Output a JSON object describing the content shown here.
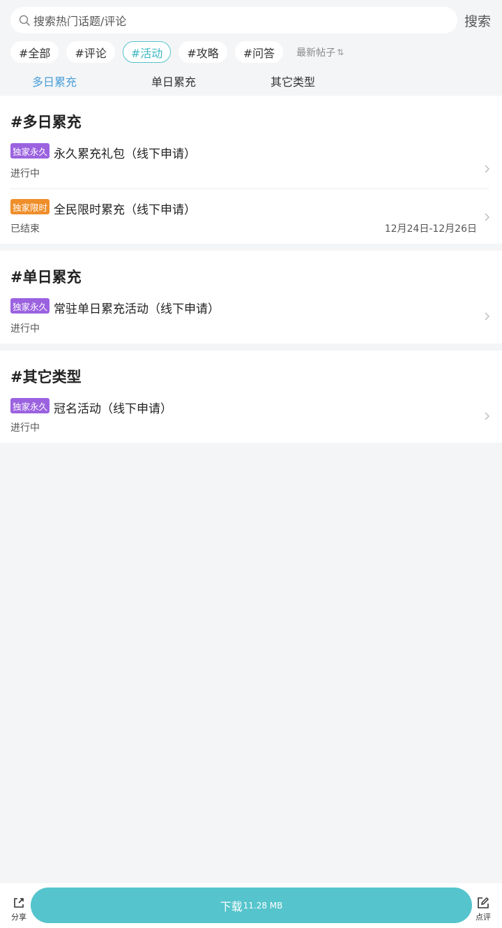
{
  "search": {
    "placeholder": "搜索热门话题/评论",
    "button_label": "搜索"
  },
  "filters": {
    "chips": [
      {
        "label": "#全部",
        "active": false
      },
      {
        "label": "#评论",
        "active": false
      },
      {
        "label": "#活动",
        "active": true
      },
      {
        "label": "#攻略",
        "active": false
      },
      {
        "label": "#问答",
        "active": false
      }
    ],
    "sort_label": "最新帖子",
    "sort_icon": "sort-arrows-icon"
  },
  "tabs": [
    {
      "label": "多日累充",
      "active": true
    },
    {
      "label": "单日累充",
      "active": false
    },
    {
      "label": "其它类型",
      "active": false
    }
  ],
  "sections": [
    {
      "title": "#多日累充",
      "items": [
        {
          "badge": "独家永久",
          "badge_color": "#9b62e0",
          "title": "永久累充礼包（线下申请）",
          "status": "进行中",
          "date": ""
        },
        {
          "badge": "独家限时",
          "badge_color": "#ef8e2a",
          "title": "全民限时累充（线下申请）",
          "status": "已结束",
          "date": "12月24日-12月26日"
        }
      ]
    },
    {
      "title": "#单日累充",
      "items": [
        {
          "badge": "独家永久",
          "badge_color": "#9b62e0",
          "title": "常驻单日累充活动（线下申请）",
          "status": "进行中",
          "date": ""
        }
      ]
    },
    {
      "title": "#其它类型",
      "items": [
        {
          "badge": "独家永久",
          "badge_color": "#9b62e0",
          "title": "冠名活动（线下申请）",
          "status": "进行中",
          "date": ""
        }
      ]
    }
  ],
  "bottom": {
    "share_label": "分享",
    "download_label": "下载",
    "download_size": "11.28 MB",
    "review_label": "点评"
  },
  "colors": {
    "accent": "#55c4cc",
    "tab_active": "#4a9fd8",
    "badge_purple": "#9b62e0",
    "badge_orange": "#ef8e2a"
  }
}
